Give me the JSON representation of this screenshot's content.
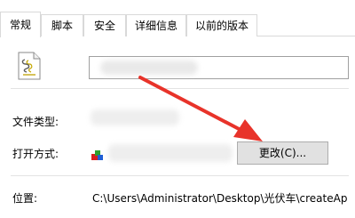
{
  "tabs": [
    {
      "label": "常规",
      "active": true
    },
    {
      "label": "脚本",
      "active": false
    },
    {
      "label": "安全",
      "active": false
    },
    {
      "label": "详细信息",
      "active": false
    },
    {
      "label": "以前的版本",
      "active": false
    }
  ],
  "file": {
    "icon": "script-file-icon"
  },
  "fields": {
    "file_type_label": "文件类型:",
    "open_with_label": "打开方式:",
    "change_button": "更改(C)...",
    "location_label": "位置:",
    "location_value": "C:\\Users\\Administrator\\Desktop\\光伏车\\createAp"
  },
  "annotation": {
    "color": "#e8332a",
    "icon": "red-arrow-pointing-to-change-button"
  }
}
